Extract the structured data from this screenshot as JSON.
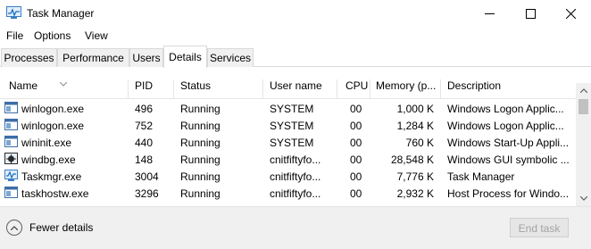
{
  "window": {
    "title": "Task Manager",
    "icon": "task-manager-icon"
  },
  "menu": [
    "File",
    "Options",
    "View"
  ],
  "tabs": [
    "Processes",
    "Performance",
    "Users",
    "Details",
    "Services"
  ],
  "active_tab": "Details",
  "columns": {
    "name": "Name",
    "pid": "PID",
    "status": "Status",
    "user": "User name",
    "cpu": "CPU",
    "memory": "Memory (p...",
    "description": "Description"
  },
  "rows": [
    {
      "icon": "app-window-icon",
      "name": "winlogon.exe",
      "pid": "496",
      "status": "Running",
      "user": "SYSTEM",
      "cpu": "00",
      "memory": "1,000 K",
      "description": "Windows Logon Applic..."
    },
    {
      "icon": "app-window-icon",
      "name": "winlogon.exe",
      "pid": "752",
      "status": "Running",
      "user": "SYSTEM",
      "cpu": "00",
      "memory": "1,284 K",
      "description": "Windows Logon Applic..."
    },
    {
      "icon": "app-window-icon",
      "name": "wininit.exe",
      "pid": "440",
      "status": "Running",
      "user": "SYSTEM",
      "cpu": "00",
      "memory": "760 K",
      "description": "Windows Start-Up Appli..."
    },
    {
      "icon": "debugger-icon",
      "name": "windbg.exe",
      "pid": "148",
      "status": "Running",
      "user": "cnitfiftyfo...",
      "cpu": "00",
      "memory": "28,548 K",
      "description": "Windows GUI symbolic ..."
    },
    {
      "icon": "task-manager-icon",
      "name": "Taskmgr.exe",
      "pid": "3004",
      "status": "Running",
      "user": "cnitfiftyfo...",
      "cpu": "00",
      "memory": "7,776 K",
      "description": "Task Manager"
    },
    {
      "icon": "app-window-icon",
      "name": "taskhostw.exe",
      "pid": "3296",
      "status": "Running",
      "user": "cnitfiftyfo...",
      "cpu": "00",
      "memory": "2,932 K",
      "description": "Host Process for Windo..."
    }
  ],
  "footer": {
    "fewer_details": "Fewer details",
    "end_task": "End task"
  },
  "colors": {
    "accent": "#0078d7",
    "footer_bg": "#f0f0f0",
    "disabled_text": "#a3a3a3"
  }
}
